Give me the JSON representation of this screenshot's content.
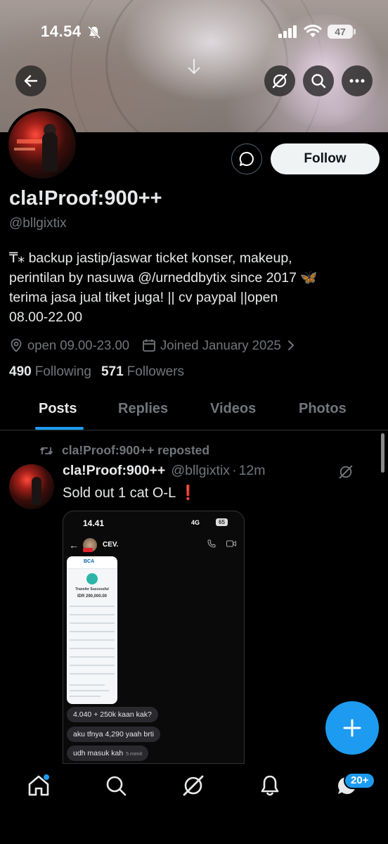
{
  "status_bar": {
    "time": "14.54",
    "battery": "47"
  },
  "profile": {
    "follow_label": "Follow",
    "display_name": "cla!Proof:900++",
    "handle": "@bllgixtix",
    "bio_line1": "₸⁎ backup jastip/jaswar ticket konser, makeup,",
    "bio_line2": "perintilan by nasuwa @/urneddbytix since 2017 ",
    "bio_emoji": "🦋",
    "bio_line3": "terima jasa jual tiket juga! || cv paypal ||open",
    "bio_line4": "08.00-22.00",
    "location": "open 09.00-23.00",
    "joined": "Joined January 2025",
    "following_count": "490",
    "following_label": "Following",
    "followers_count": "571",
    "followers_label": "Followers"
  },
  "tabs": [
    {
      "label": "Posts",
      "active": true
    },
    {
      "label": "Replies",
      "active": false
    },
    {
      "label": "Videos",
      "active": false
    },
    {
      "label": "Photos",
      "active": false
    }
  ],
  "tweet": {
    "repost_label": "cla!Proof:900++ reposted",
    "author_name": "cla!Proof:900++",
    "author_handle": "@bllgixtix",
    "separator": "·",
    "time": "12m",
    "text": "Sold out 1 cat O-L",
    "emoji": "❗",
    "image": {
      "time": "14.41",
      "network": "4G",
      "battery": "65",
      "contact": "CEV.",
      "bank": "BCA",
      "receipt_title": "Transfer Successful",
      "amount": "IDR 290,000.00",
      "messages": [
        {
          "text": "4.040 + 250k kaan kak?",
          "ts": ""
        },
        {
          "text": "aku tfnya 4,290 yaah brti",
          "ts": ""
        },
        {
          "text": "udh masuk kah",
          "ts": "5 menit"
        }
      ]
    }
  },
  "messages_badge": "20+",
  "colors": {
    "accent": "#1d9bf0",
    "text": "#e7e9ea",
    "muted": "#71767b",
    "background": "#000000"
  }
}
